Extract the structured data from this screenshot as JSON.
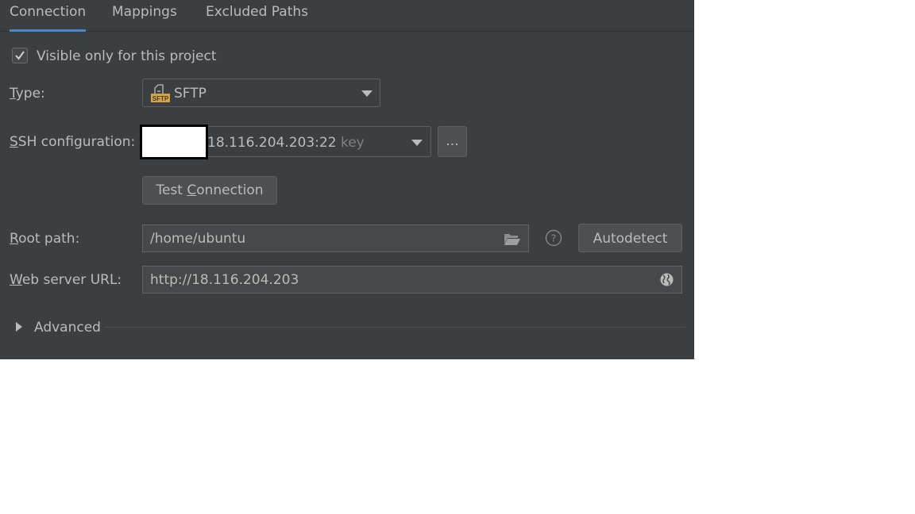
{
  "tabs": [
    {
      "label": "Connection",
      "active": true
    },
    {
      "label": "Mappings",
      "active": false
    },
    {
      "label": "Excluded Paths",
      "active": false
    }
  ],
  "visible_only": {
    "label": "Visible only for this project",
    "checked": true
  },
  "type": {
    "label_mnemonic": "T",
    "label_rest": "ype:",
    "value": "SFTP",
    "icon": "sftp-icon",
    "icon_text": "SFTP"
  },
  "ssh": {
    "label_mnemonic": "S",
    "label_rest": "SH configuration:",
    "value": "18.116.204.203:22",
    "hint": "key",
    "more_label": "..."
  },
  "test_button": {
    "pre": "Test ",
    "mnemonic": "C",
    "post": "onnection"
  },
  "root_path": {
    "label_mnemonic": "R",
    "label_rest": "oot path:",
    "value": "/home/ubuntu",
    "autodetect_label": "Autodetect"
  },
  "web_url": {
    "label_mnemonic": "W",
    "label_rest": "eb server URL:",
    "value": "http://18.116.204.203"
  },
  "advanced": {
    "label": "Advanced",
    "expanded": false
  },
  "colors": {
    "accent": "#4a88c7",
    "panel": "#3c3f41",
    "text": "#bbbbbb",
    "sftp_icon": "#d9a343"
  }
}
